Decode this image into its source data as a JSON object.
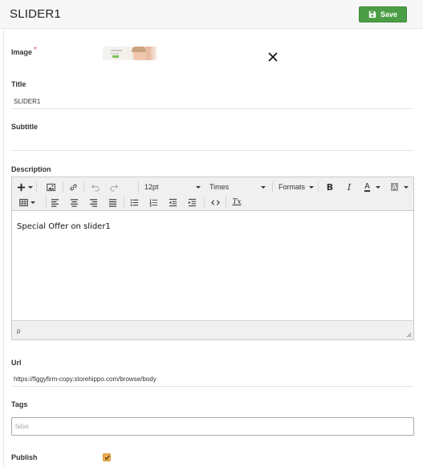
{
  "header": {
    "title": "SLIDER1",
    "save_label": "Save",
    "save_icon": "floppy-disk-icon",
    "save_color": "#4c9e46"
  },
  "form": {
    "image": {
      "label": "Image",
      "required_mark": "*",
      "thumbnail": "slider-thumbnail",
      "remove_icon": "close-icon"
    },
    "title": {
      "label": "Title",
      "value": "SLIDER1"
    },
    "subtitle": {
      "label": "Subtitle",
      "value": ""
    },
    "description": {
      "label": "Description",
      "toolbar": {
        "insert_icon": "plus-icon",
        "image_icon": "image-icon",
        "link_icon": "link-icon",
        "undo_icon": "undo-icon",
        "redo_icon": "redo-icon",
        "font_size": "12pt",
        "font_family": "Times",
        "formats_label": "Formats",
        "bold_label": "B",
        "italic_label": "I",
        "text_color_label": "A",
        "bg_color_label": "A",
        "clear_format_label": "Tx"
      },
      "content": "Special Offer on slider1",
      "path": "p"
    },
    "url": {
      "label": "Url",
      "value": "https://figgyfirm-copy.storehippo.com/browse/body"
    },
    "tags": {
      "label": "Tags",
      "placeholder": "false"
    },
    "publish": {
      "label": "Publish",
      "checked": true,
      "color": "#f0ad4e"
    }
  }
}
